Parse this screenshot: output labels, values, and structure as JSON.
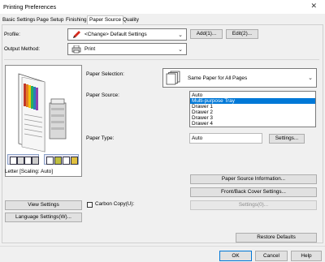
{
  "window": {
    "title": "Printing Preferences",
    "close_glyph": "✕"
  },
  "tabs": [
    "Basic Settings",
    "Page Setup",
    "Finishing",
    "Paper Source",
    "Quality"
  ],
  "profile": {
    "label": "Profile:",
    "value": "<Change> Default Settings",
    "add_label": "Add(1)...",
    "edit_label": "Edit(2)..."
  },
  "output_method": {
    "label": "Output Method:",
    "value": "Print"
  },
  "preview": {
    "caption": "Letter [Scaling: Auto]"
  },
  "paper_selection": {
    "label": "Paper Selection:",
    "value": "Same Paper for All Pages"
  },
  "paper_source": {
    "label": "Paper Source:",
    "options": [
      "Auto",
      "Multi-purpose Tray",
      "Drawer 1",
      "Drawer 2",
      "Drawer 3",
      "Drawer 4"
    ],
    "selected_index": 1
  },
  "paper_type": {
    "label": "Paper Type:",
    "value": "Auto",
    "settings_label": "Settings..."
  },
  "buttons": {
    "paper_source_info": "Paper Source Information...",
    "front_back_cover": "Front/Back Cover Settings...",
    "settings_disabled": "Settings(0)...",
    "view_settings": "View Settings",
    "language_settings": "Language Settings(W)...",
    "restore_defaults": "Restore Defaults",
    "ok": "OK",
    "cancel": "Cancel",
    "help": "Help"
  },
  "carbon_copy": {
    "label": "Carbon Copy(U):",
    "checked": false
  },
  "colors": {
    "accent": "#0078d7"
  }
}
